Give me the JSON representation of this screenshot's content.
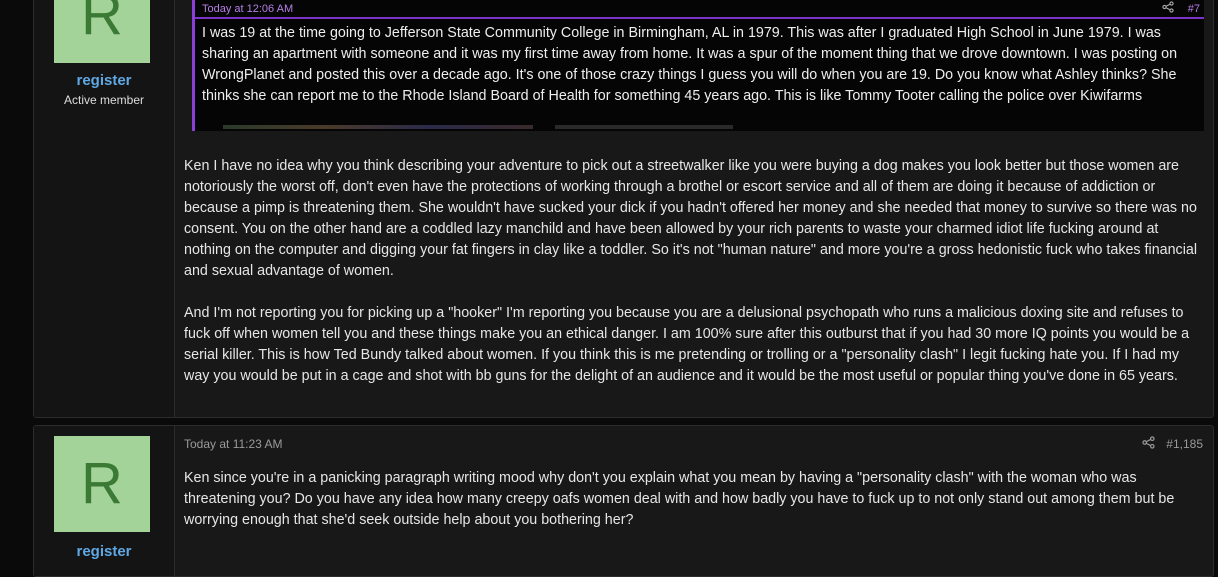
{
  "posts": [
    {
      "avatar_letter": "R",
      "username": "register",
      "user_title": "Active member",
      "quote": {
        "time": "Today at 12:06 AM",
        "number": "#7",
        "text": "I was 19 at the time going to Jefferson State Community College in Birmingham, AL in 1979. This was after I graduated High School in June 1979. I was sharing an apartment with someone and it was my first time away from home. It was a spur of the moment thing that we drove downtown. I was posting on WrongPlanet and posted this over a decade ago. It's one of those crazy things I guess you will do when you are 19. Do you know what Ashley thinks? She thinks she can report me to the Rhode Island Board of Health for something 45 years ago. This is like Tommy Tooter calling the police over Kiwifarms"
      },
      "paragraphs": [
        "Ken I have no idea why you think describing your adventure to pick out a streetwalker like you were buying a dog makes you look better but those women are notoriously the worst off, don't even have the protections of working through a brothel or escort service and all of them are doing it because of addiction or because a pimp is threatening them. She wouldn't have sucked your dick if you hadn't offered her money and she needed that money to survive so there was no consent. You on the other hand are a coddled lazy manchild and have been allowed by your rich parents to waste your charmed idiot life fucking around at nothing on the computer and digging your fat fingers in clay like a toddler. So it's not \"human nature\" and more you're a gross hedonistic fuck who takes financial and sexual advantage of women.",
        "And I'm not reporting you for picking up a \"hooker\" I'm reporting you because you are a delusional psychopath who runs a malicious doxing site and refuses to fuck off when women tell you and these things make you an ethical danger. I am 100% sure after this outburst that if you had 30 more IQ points you would be a serial killer. This is how Ted Bundy talked about women. If you think this is me pretending or trolling or a \"personality clash\" I legit fucking hate you. If I had my way you would be put in a cage and shot with bb guns for the delight of an audience and it would be the most useful or popular thing you've done in 65 years."
      ]
    },
    {
      "avatar_letter": "R",
      "username": "register",
      "time": "Today at 11:23 AM",
      "number": "#1,185",
      "paragraphs": [
        "Ken since you're in a panicking paragraph writing mood why don't you explain what you mean by having a \"personality clash\" with the woman who was threatening you? Do you have any idea how many creepy oafs women deal with and how badly you have to fuck up to not only stand out among them but be worrying enough that she'd seek outside help about you bothering her?"
      ]
    }
  ],
  "icons": {
    "share": "share-icon"
  },
  "colors": {
    "accent": "#8a3fd6",
    "username": "#5fa8e4",
    "avatar_bg": "#a4d39a",
    "avatar_fg": "#3a7a35"
  }
}
